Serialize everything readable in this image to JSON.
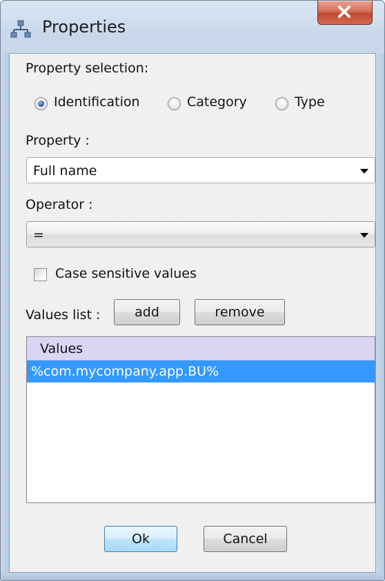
{
  "window": {
    "title": "Properties",
    "icon": "hierarchy-icon",
    "close_icon": "close-icon"
  },
  "property_selection": {
    "label": "Property selection:",
    "options": [
      {
        "label": "Identification",
        "checked": true
      },
      {
        "label": "Category",
        "checked": false
      },
      {
        "label": "Type",
        "checked": false
      }
    ]
  },
  "property": {
    "label": "Property :",
    "value": "Full name"
  },
  "operator": {
    "label": "Operator :",
    "value": "="
  },
  "case_sensitive": {
    "label": "Case sensitive values",
    "checked": false
  },
  "values_list": {
    "label": "Values list :",
    "add_label": "add",
    "remove_label": "remove",
    "column_header": "Values",
    "rows": [
      "%com.mycompany.app.BU%"
    ],
    "selected_row": 0
  },
  "buttons": {
    "ok": "Ok",
    "cancel": "Cancel"
  },
  "colors": {
    "selection": "#3399ff",
    "list_header": "#d9d6f4",
    "close": "#c2482f"
  }
}
